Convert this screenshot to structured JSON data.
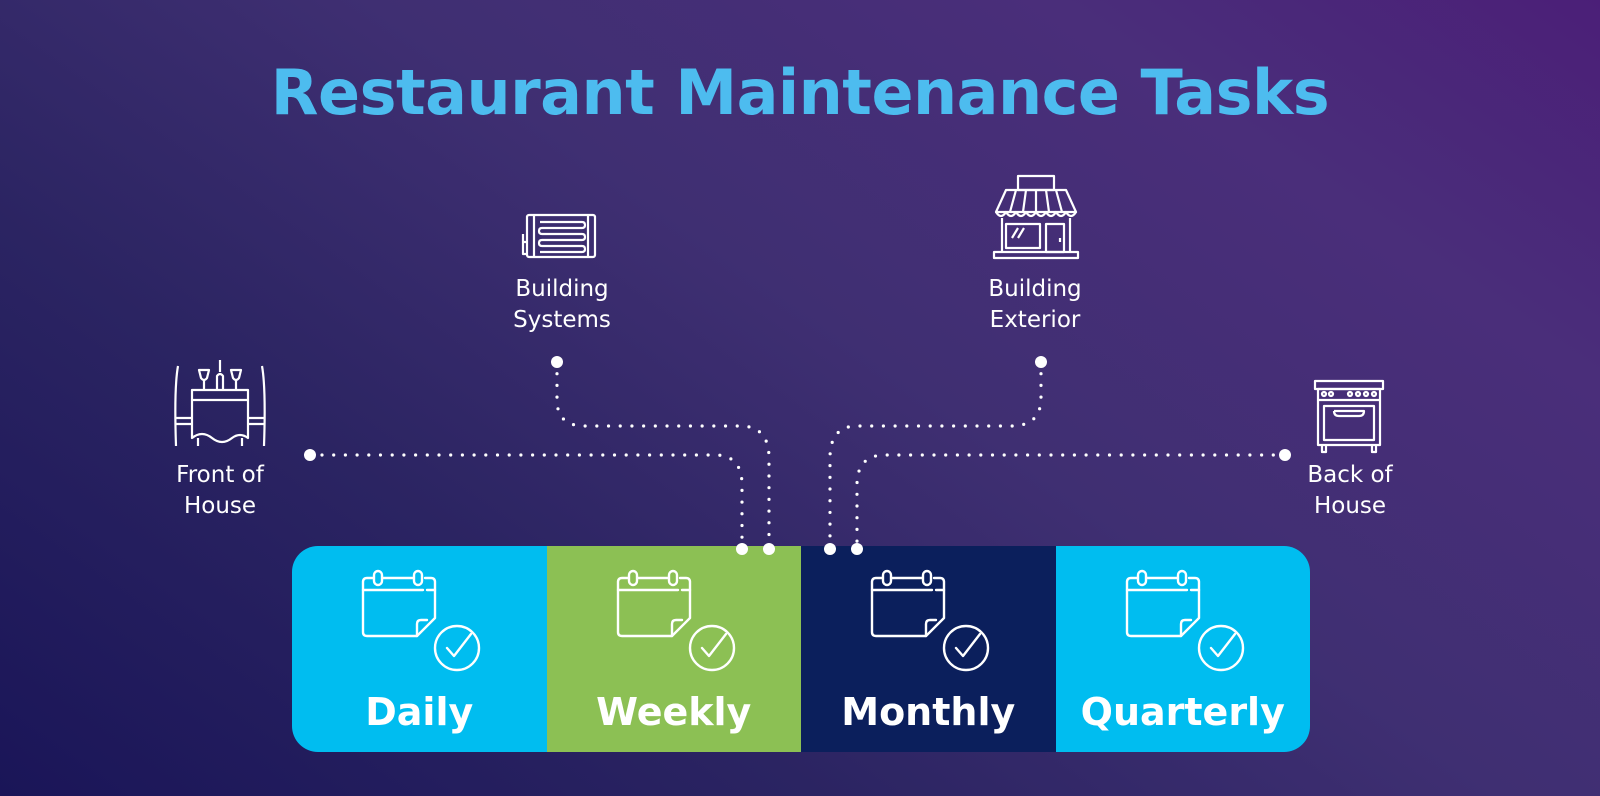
{
  "title": "Restaurant Maintenance Tasks",
  "colors": {
    "title": "#4dbcef",
    "daily": "#00bdf0",
    "weekly": "#8cc054",
    "monthly": "#0b1f5c",
    "quarterly": "#00bdf0",
    "stroke": "#ffffff"
  },
  "categories": [
    {
      "id": "front-of-house",
      "label_line1": "Front of",
      "label_line2": "House",
      "icon": "dining-table-icon"
    },
    {
      "id": "building-systems",
      "label_line1": "Building",
      "label_line2": "Systems",
      "icon": "radiator-icon"
    },
    {
      "id": "building-exterior",
      "label_line1": "Building",
      "label_line2": "Exterior",
      "icon": "storefront-icon"
    },
    {
      "id": "back-of-house",
      "label_line1": "Back of",
      "label_line2": "House",
      "icon": "stove-oven-icon"
    }
  ],
  "frequencies": [
    {
      "label": "Daily",
      "icon": "calendar-check-icon"
    },
    {
      "label": "Weekly",
      "icon": "calendar-check-icon"
    },
    {
      "label": "Monthly",
      "icon": "calendar-check-icon"
    },
    {
      "label": "Quarterly",
      "icon": "calendar-check-icon"
    }
  ]
}
